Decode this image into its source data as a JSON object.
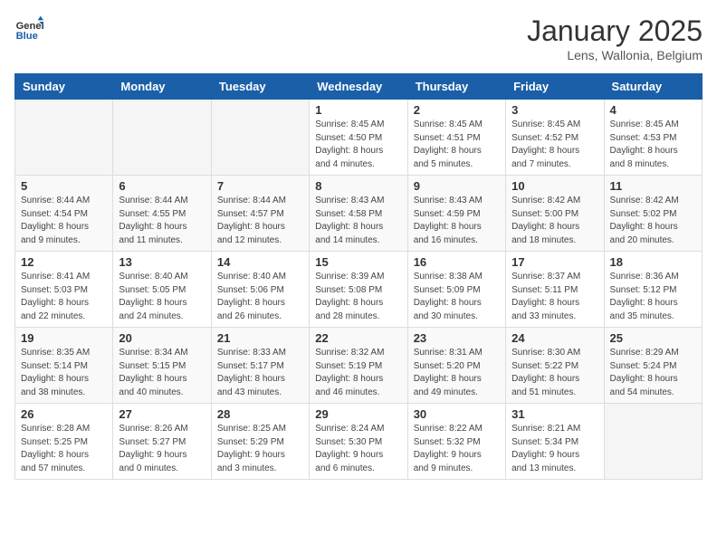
{
  "header": {
    "logo_general": "General",
    "logo_blue": "Blue",
    "month": "January 2025",
    "location": "Lens, Wallonia, Belgium"
  },
  "weekdays": [
    "Sunday",
    "Monday",
    "Tuesday",
    "Wednesday",
    "Thursday",
    "Friday",
    "Saturday"
  ],
  "weeks": [
    [
      {
        "day": "",
        "info": ""
      },
      {
        "day": "",
        "info": ""
      },
      {
        "day": "",
        "info": ""
      },
      {
        "day": "1",
        "info": "Sunrise: 8:45 AM\nSunset: 4:50 PM\nDaylight: 8 hours\nand 4 minutes."
      },
      {
        "day": "2",
        "info": "Sunrise: 8:45 AM\nSunset: 4:51 PM\nDaylight: 8 hours\nand 5 minutes."
      },
      {
        "day": "3",
        "info": "Sunrise: 8:45 AM\nSunset: 4:52 PM\nDaylight: 8 hours\nand 7 minutes."
      },
      {
        "day": "4",
        "info": "Sunrise: 8:45 AM\nSunset: 4:53 PM\nDaylight: 8 hours\nand 8 minutes."
      }
    ],
    [
      {
        "day": "5",
        "info": "Sunrise: 8:44 AM\nSunset: 4:54 PM\nDaylight: 8 hours\nand 9 minutes."
      },
      {
        "day": "6",
        "info": "Sunrise: 8:44 AM\nSunset: 4:55 PM\nDaylight: 8 hours\nand 11 minutes."
      },
      {
        "day": "7",
        "info": "Sunrise: 8:44 AM\nSunset: 4:57 PM\nDaylight: 8 hours\nand 12 minutes."
      },
      {
        "day": "8",
        "info": "Sunrise: 8:43 AM\nSunset: 4:58 PM\nDaylight: 8 hours\nand 14 minutes."
      },
      {
        "day": "9",
        "info": "Sunrise: 8:43 AM\nSunset: 4:59 PM\nDaylight: 8 hours\nand 16 minutes."
      },
      {
        "day": "10",
        "info": "Sunrise: 8:42 AM\nSunset: 5:00 PM\nDaylight: 8 hours\nand 18 minutes."
      },
      {
        "day": "11",
        "info": "Sunrise: 8:42 AM\nSunset: 5:02 PM\nDaylight: 8 hours\nand 20 minutes."
      }
    ],
    [
      {
        "day": "12",
        "info": "Sunrise: 8:41 AM\nSunset: 5:03 PM\nDaylight: 8 hours\nand 22 minutes."
      },
      {
        "day": "13",
        "info": "Sunrise: 8:40 AM\nSunset: 5:05 PM\nDaylight: 8 hours\nand 24 minutes."
      },
      {
        "day": "14",
        "info": "Sunrise: 8:40 AM\nSunset: 5:06 PM\nDaylight: 8 hours\nand 26 minutes."
      },
      {
        "day": "15",
        "info": "Sunrise: 8:39 AM\nSunset: 5:08 PM\nDaylight: 8 hours\nand 28 minutes."
      },
      {
        "day": "16",
        "info": "Sunrise: 8:38 AM\nSunset: 5:09 PM\nDaylight: 8 hours\nand 30 minutes."
      },
      {
        "day": "17",
        "info": "Sunrise: 8:37 AM\nSunset: 5:11 PM\nDaylight: 8 hours\nand 33 minutes."
      },
      {
        "day": "18",
        "info": "Sunrise: 8:36 AM\nSunset: 5:12 PM\nDaylight: 8 hours\nand 35 minutes."
      }
    ],
    [
      {
        "day": "19",
        "info": "Sunrise: 8:35 AM\nSunset: 5:14 PM\nDaylight: 8 hours\nand 38 minutes."
      },
      {
        "day": "20",
        "info": "Sunrise: 8:34 AM\nSunset: 5:15 PM\nDaylight: 8 hours\nand 40 minutes."
      },
      {
        "day": "21",
        "info": "Sunrise: 8:33 AM\nSunset: 5:17 PM\nDaylight: 8 hours\nand 43 minutes."
      },
      {
        "day": "22",
        "info": "Sunrise: 8:32 AM\nSunset: 5:19 PM\nDaylight: 8 hours\nand 46 minutes."
      },
      {
        "day": "23",
        "info": "Sunrise: 8:31 AM\nSunset: 5:20 PM\nDaylight: 8 hours\nand 49 minutes."
      },
      {
        "day": "24",
        "info": "Sunrise: 8:30 AM\nSunset: 5:22 PM\nDaylight: 8 hours\nand 51 minutes."
      },
      {
        "day": "25",
        "info": "Sunrise: 8:29 AM\nSunset: 5:24 PM\nDaylight: 8 hours\nand 54 minutes."
      }
    ],
    [
      {
        "day": "26",
        "info": "Sunrise: 8:28 AM\nSunset: 5:25 PM\nDaylight: 8 hours\nand 57 minutes."
      },
      {
        "day": "27",
        "info": "Sunrise: 8:26 AM\nSunset: 5:27 PM\nDaylight: 9 hours\nand 0 minutes."
      },
      {
        "day": "28",
        "info": "Sunrise: 8:25 AM\nSunset: 5:29 PM\nDaylight: 9 hours\nand 3 minutes."
      },
      {
        "day": "29",
        "info": "Sunrise: 8:24 AM\nSunset: 5:30 PM\nDaylight: 9 hours\nand 6 minutes."
      },
      {
        "day": "30",
        "info": "Sunrise: 8:22 AM\nSunset: 5:32 PM\nDaylight: 9 hours\nand 9 minutes."
      },
      {
        "day": "31",
        "info": "Sunrise: 8:21 AM\nSunset: 5:34 PM\nDaylight: 9 hours\nand 13 minutes."
      },
      {
        "day": "",
        "info": ""
      }
    ]
  ]
}
